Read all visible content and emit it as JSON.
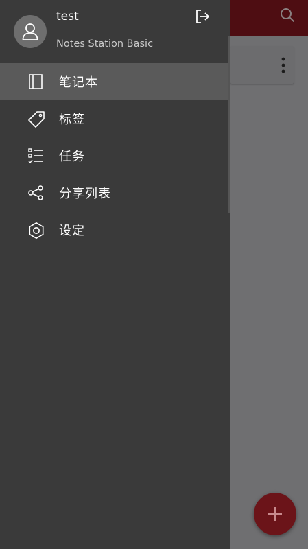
{
  "drawer": {
    "user_name": "test",
    "app_name": "Notes Station Basic",
    "menu": [
      {
        "label": "笔记本",
        "icon": "notebook-icon",
        "active": true
      },
      {
        "label": "标签",
        "icon": "tag-icon",
        "active": false
      },
      {
        "label": "任务",
        "icon": "checklist-icon",
        "active": false
      },
      {
        "label": "分享列表",
        "icon": "share-icon",
        "active": false
      },
      {
        "label": "设定",
        "icon": "gear-icon",
        "active": false
      }
    ]
  },
  "colors": {
    "header_bg": "#4e0d12",
    "drawer_bg": "#3a3a3a",
    "active_item_bg": "#5a5a5a",
    "fab_bg": "#6b1419"
  }
}
